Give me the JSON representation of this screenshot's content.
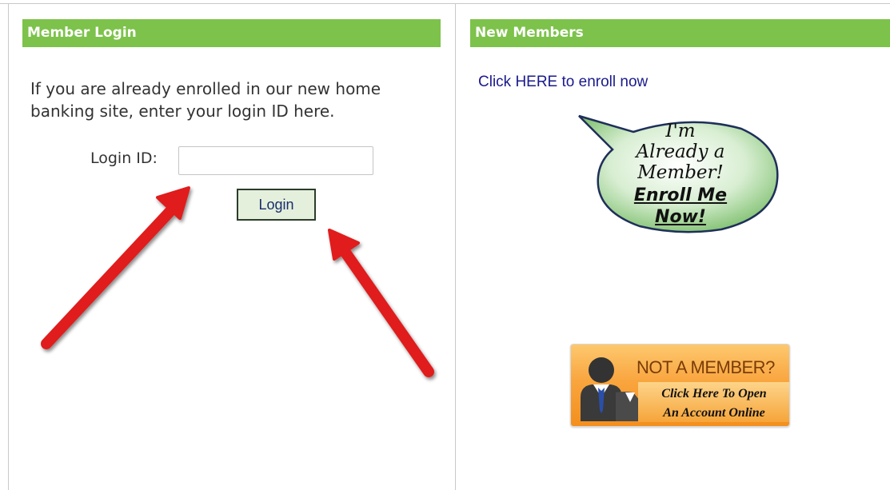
{
  "member_login": {
    "header": "Member Login",
    "intro": "If you are already enrolled in our new home banking site, enter your login ID here.",
    "login_label": "Login ID:",
    "login_value": "",
    "login_button": "Login"
  },
  "new_members": {
    "header": "New Members",
    "enroll_link": "Click HERE to enroll now",
    "bubble": {
      "line1": "I'm",
      "line2": "Already a",
      "line3": "Member!",
      "line4": "Enroll Me",
      "line5": "Now!"
    },
    "not_member": {
      "title": "NOT A MEMBER?",
      "sub1": "Click Here To Open",
      "sub2": "An Account Online"
    }
  },
  "icons": [
    "speech-bubble-icon",
    "person-icon",
    "arrow-icon"
  ],
  "colors": {
    "header_green": "#7dc24b",
    "link_blue": "#1a1a8c",
    "arrow_red": "#e01d1d",
    "button_bg": "#e4f0dc",
    "bubble_green": "#9dd28e",
    "badge_orange": "#f9a53e"
  }
}
